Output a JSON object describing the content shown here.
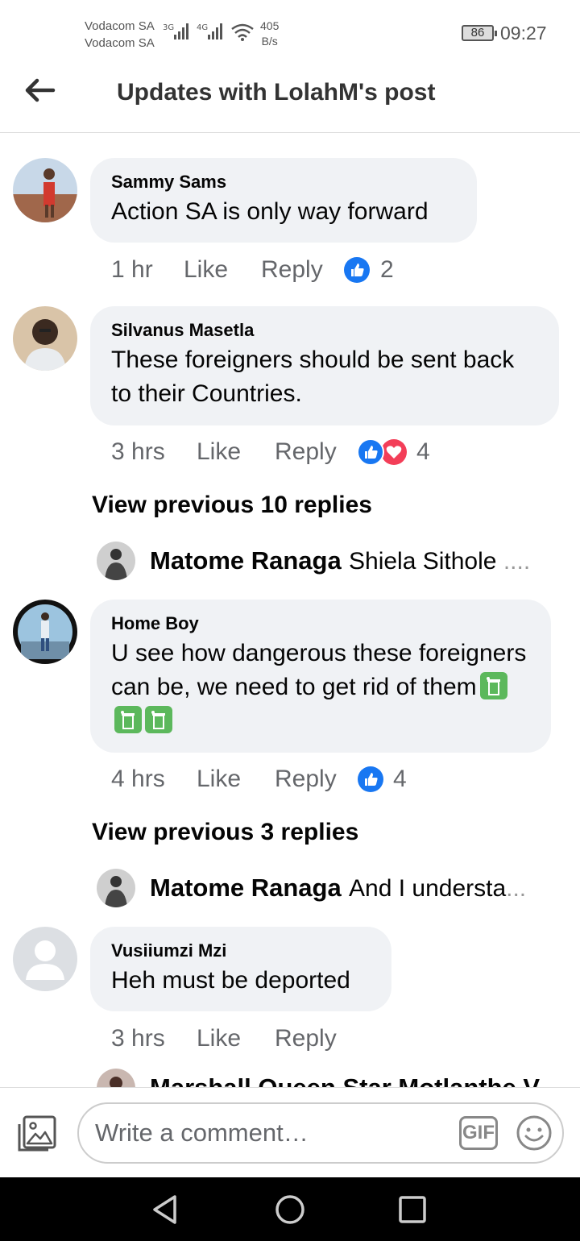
{
  "status_bar": {
    "carrier_1": "Vodacom SA",
    "carrier_2": "Vodacom SA",
    "net_1": "3G",
    "net_2": "4G",
    "speed_value": "405",
    "speed_unit": "B/s",
    "battery": "86",
    "time": "09:27"
  },
  "header": {
    "title": "Updates with LolahM's post"
  },
  "comments": [
    {
      "author": "Sammy Sams",
      "text": "Action SA is only way forward",
      "time": "1 hr",
      "like_label": "Like",
      "reply_label": "Reply",
      "reactions": [
        "like-icon"
      ],
      "reaction_count": "2"
    },
    {
      "author": "Silvanus Masetla",
      "text": "These foreigners should be sent back to their Countries.",
      "time": "3 hrs",
      "like_label": "Like",
      "reply_label": "Reply",
      "reactions": [
        "like-icon",
        "love-icon"
      ],
      "reaction_count": "4"
    },
    {
      "author": "Home Boy",
      "text": "U see how dangerous these foreigners can be,  we need to get rid of them",
      "time": "4 hrs",
      "like_label": "Like",
      "reply_label": "Reply",
      "reactions": [
        "like-icon"
      ],
      "reaction_count": "4"
    },
    {
      "author": "Vusiiumzi Mzi",
      "text": "Heh must be deported",
      "time": "3 hrs",
      "like_label": "Like",
      "reply_label": "Reply"
    }
  ],
  "view_previous": [
    {
      "label": "View previous 10 replies"
    },
    {
      "label": "View previous 3 replies"
    }
  ],
  "reply_previews": [
    {
      "author": "Matome Ranaga",
      "text": "Shiela Sithole",
      "ellipsis": "...."
    },
    {
      "author": "Matome Ranaga",
      "text": "And I understa",
      "ellipsis": "..."
    }
  ],
  "clipped_bottom_author": "Marshall Queen Star Motlanthe V",
  "composer": {
    "placeholder": "Write a comment…",
    "gif_label": "GIF"
  },
  "colors": {
    "like_blue": "#1877f2",
    "love_red": "#f33e58",
    "bubble_bg": "#f0f2f5",
    "secondary_text": "#65676b"
  }
}
